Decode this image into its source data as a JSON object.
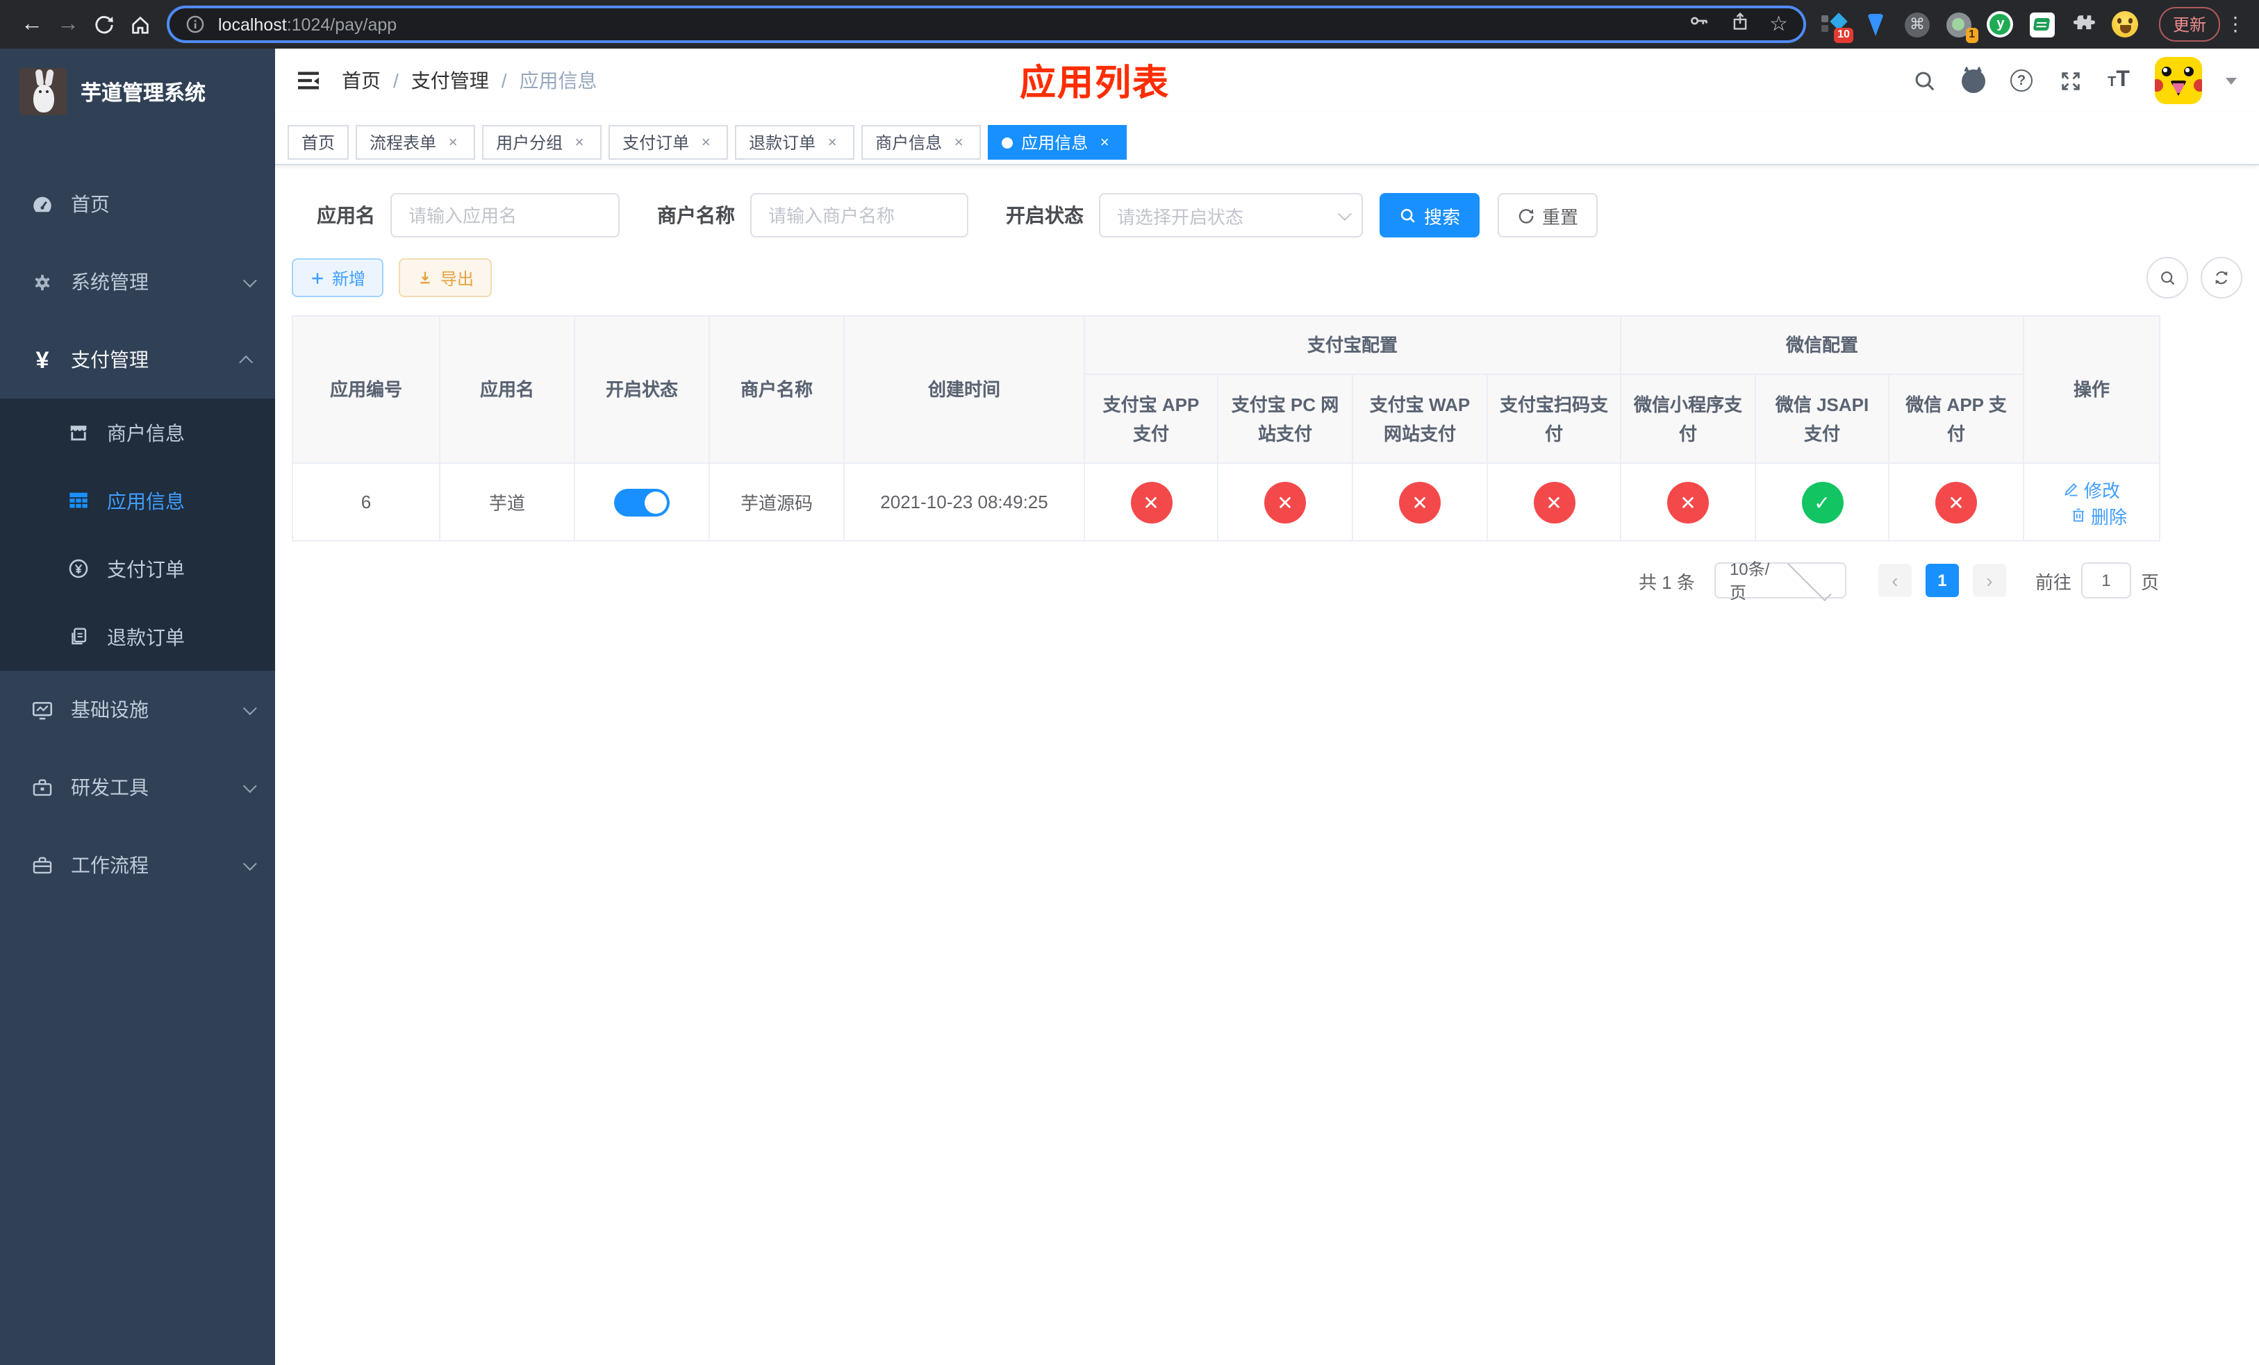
{
  "browser": {
    "url_host": "localhost",
    "url_path": ":1024/pay/app",
    "update_button": "更新",
    "ext_badge_tabs": "10",
    "ext_badge_session": "1"
  },
  "sidebar": {
    "title": "芋道管理系统",
    "items": [
      {
        "label": "首页"
      },
      {
        "label": "系统管理"
      },
      {
        "label": "支付管理"
      },
      {
        "label": "基础设施"
      },
      {
        "label": "研发工具"
      },
      {
        "label": "工作流程"
      }
    ],
    "submenu": [
      {
        "label": "商户信息"
      },
      {
        "label": "应用信息"
      },
      {
        "label": "支付订单"
      },
      {
        "label": "退款订单"
      }
    ]
  },
  "header": {
    "breadcrumb": [
      "首页",
      "支付管理",
      "应用信息"
    ],
    "annotation": "应用列表"
  },
  "tabs": [
    {
      "label": "首页"
    },
    {
      "label": "流程表单"
    },
    {
      "label": "用户分组"
    },
    {
      "label": "支付订单"
    },
    {
      "label": "退款订单"
    },
    {
      "label": "商户信息"
    },
    {
      "label": "应用信息"
    }
  ],
  "filters": {
    "app_name_label": "应用名",
    "app_name_placeholder": "请输入应用名",
    "merchant_label": "商户名称",
    "merchant_placeholder": "请输入商户名称",
    "status_label": "开启状态",
    "status_placeholder": "请选择开启状态",
    "search_button": "搜索",
    "reset_button": "重置"
  },
  "toolbar": {
    "add_button": "新增",
    "export_button": "导出"
  },
  "table": {
    "columns": [
      "应用编号",
      "应用名",
      "开启状态",
      "商户名称",
      "创建时间"
    ],
    "group_alipay": "支付宝配置",
    "group_wechat": "微信配置",
    "sub_columns": [
      "支付宝 APP 支付",
      "支付宝 PC 网站支付",
      "支付宝 WAP 网站支付",
      "支付宝扫码支付",
      "微信小程序支付",
      "微信 JSAPI 支付",
      "微信 APP 支付"
    ],
    "ops_column": "操作",
    "row": {
      "id": "6",
      "name": "芋道",
      "status_on": true,
      "merchant": "芋道源码",
      "created": "2021-10-23 08:49:25",
      "configs": [
        "fail",
        "fail",
        "fail",
        "fail",
        "fail",
        "success",
        "fail"
      ],
      "edit_label": "修改",
      "delete_label": "删除"
    }
  },
  "pagination": {
    "total": "共 1 条",
    "page_size": "10条/页",
    "current_page": "1",
    "goto_label": "前往",
    "goto_value": "1",
    "page_suffix": "页"
  },
  "colors": {
    "primary": "#1890ff",
    "danger": "#f4494b",
    "success": "#12c462",
    "annotation": "#ff2d00",
    "sidebar_bg": "#304156",
    "submenu_bg": "#1f2d3d"
  }
}
